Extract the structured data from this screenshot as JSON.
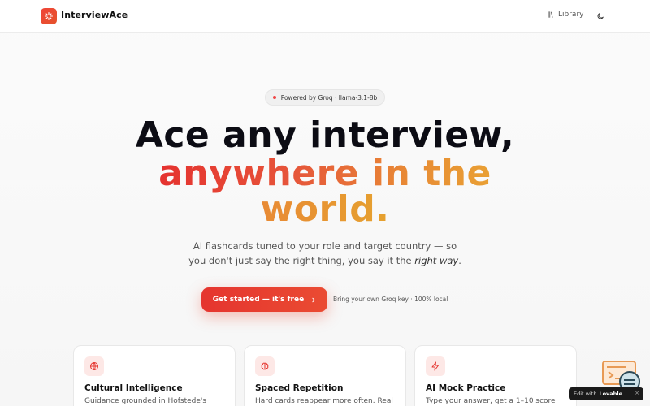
{
  "header": {
    "brand": "InterviewAce",
    "library_label": "Library",
    "icons": {
      "logo": "sparkles-icon",
      "library": "library-icon",
      "theme": "moon-icon"
    }
  },
  "badge": {
    "text": "Powered by Groq · llama-3.1-8b"
  },
  "hero": {
    "line1": "Ace any interview,",
    "line2": "anywhere in the",
    "line3": "world.",
    "subtitle_line1": "AI flashcards tuned to your role and target country — so",
    "subtitle_line2_start": "you don't just say the right thing, you say it the ",
    "subtitle_line2_em": "right way",
    "subtitle_line2_end": "."
  },
  "cta": {
    "label": "Get started — it's free",
    "note": "Bring your own Groq key · 100% local"
  },
  "features": [
    {
      "title": "Cultural Intelligence",
      "description": "Guidance grounded in Hofstede's",
      "icon": "globe-icon"
    },
    {
      "title": "Spaced Repetition",
      "description": "Hard cards reappear more often. Real",
      "icon": "brain-icon"
    },
    {
      "title": "AI Mock Practice",
      "description": "Type your answer, get a 1–10 score",
      "icon": "zap-icon"
    }
  ],
  "edit_badge": {
    "prefix": "Edit with",
    "brand": "Lovable",
    "close": "×"
  },
  "colors": {
    "accent": "#e5352f",
    "accent_orange": "#e9a034"
  }
}
